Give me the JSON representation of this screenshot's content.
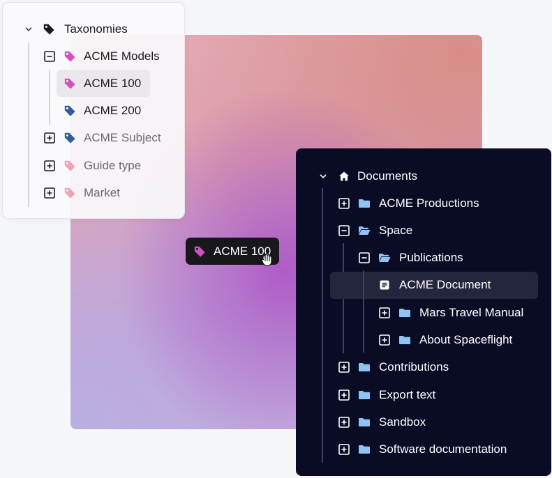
{
  "colors": {
    "tag_pink": "#d64fc0",
    "tag_blue": "#2f5f9a",
    "tag_light_pink": "#f0a3b0",
    "folder_blue": "#8ec4f5",
    "doc_panel_bg": "#0a0c26",
    "selected_bg": "#ebe8ec"
  },
  "taxonomy_tree": {
    "root": {
      "label": "Taxonomies",
      "icon": "tag-icon"
    },
    "items": [
      {
        "label": "ACME Models",
        "icon": "tag-icon",
        "state": "expanded"
      },
      {
        "label": "ACME 100",
        "icon": "tag-icon",
        "selected": true
      },
      {
        "label": "ACME 200",
        "icon": "tag-icon"
      },
      {
        "label": "ACME Subject",
        "icon": "tag-icon",
        "state": "collapsed"
      },
      {
        "label": "Guide type",
        "icon": "tag-icon",
        "state": "collapsed"
      },
      {
        "label": "Market",
        "icon": "tag-icon",
        "state": "collapsed"
      }
    ]
  },
  "drag_chip": {
    "label": "ACME 100",
    "icon": "tag-icon",
    "cursor": "grab-cursor-icon"
  },
  "document_tree": {
    "root": {
      "label": "Documents",
      "icon": "home-icon"
    },
    "items": [
      {
        "label": "ACME Productions",
        "icon": "folder-icon",
        "state": "collapsed"
      },
      {
        "label": "Space",
        "icon": "folder-open-icon",
        "state": "expanded"
      },
      {
        "label": "Publications",
        "icon": "folder-open-icon",
        "state": "expanded"
      },
      {
        "label": "ACME Document",
        "icon": "document-icon",
        "highlighted": true
      },
      {
        "label": "Mars Travel Manual",
        "icon": "folder-icon",
        "state": "collapsed"
      },
      {
        "label": "About Spaceflight",
        "icon": "folder-icon",
        "state": "collapsed"
      },
      {
        "label": "Contributions",
        "icon": "folder-icon",
        "state": "collapsed"
      },
      {
        "label": "Export text",
        "icon": "folder-icon",
        "state": "collapsed"
      },
      {
        "label": "Sandbox",
        "icon": "folder-icon",
        "state": "collapsed"
      },
      {
        "label": "Software documentation",
        "icon": "folder-icon",
        "state": "collapsed"
      }
    ]
  }
}
